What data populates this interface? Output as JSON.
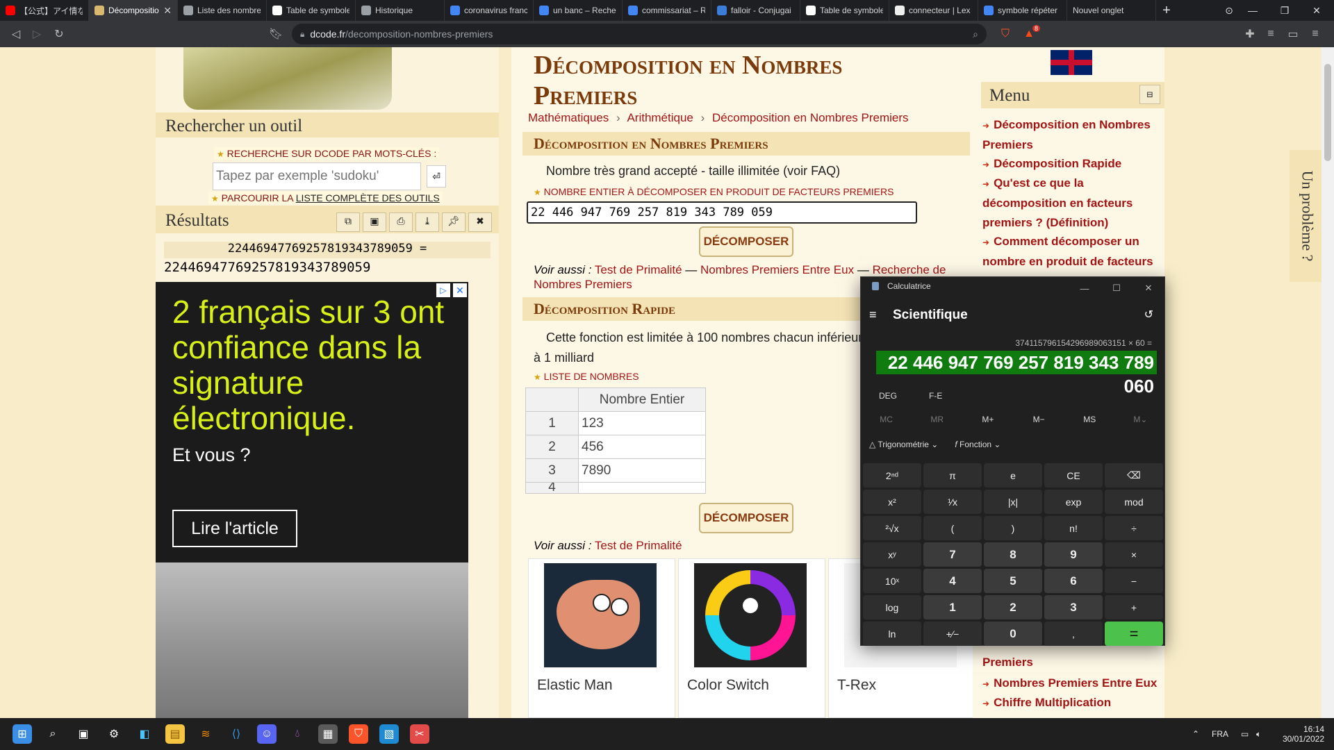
{
  "browser": {
    "tabs": [
      {
        "label": "【公式】アイ情な",
        "color": "#ff0000"
      },
      {
        "label": "Décompositio",
        "color": "#d9b870",
        "active": true
      },
      {
        "label": "Liste des nombre",
        "color": "#9aa0a6"
      },
      {
        "label": "Table de symbole",
        "color": "#ffffff"
      },
      {
        "label": "Historique",
        "color": "#9aa0a6"
      },
      {
        "label": "coronavirus franc",
        "color": "#4285f4"
      },
      {
        "label": "un banc – Recher",
        "color": "#4285f4"
      },
      {
        "label": "commissariat – R",
        "color": "#4285f4"
      },
      {
        "label": "falloir - Conjugai",
        "color": "#3b7dd8"
      },
      {
        "label": "Table de symbole",
        "color": "#ffffff"
      },
      {
        "label": "connecteur | Lex",
        "color": "#eeeeee"
      },
      {
        "label": "symbole répéter",
        "color": "#4285f4"
      },
      {
        "label": "Nouvel onglet",
        "color": ""
      }
    ],
    "new_tab": "+",
    "url_host": "dcode.fr",
    "url_path": "/decomposition-nombres-premiers",
    "shield_badge": "8"
  },
  "left": {
    "search_title": "Rechercher un outil",
    "search_label": "RECHERCHE SUR DCODE PAR MOTS-CLÉS :",
    "search_placeholder": "Tapez par exemple 'sudoku'",
    "browse_prefix": "PARCOURIR LA",
    "browse_link": "LISTE COMPLÈTE DES OUTILS",
    "results_title": "Résultats",
    "result_expr": "22446947769257819343789059 =",
    "result_value": "22446947769257819343789059",
    "ad_headline": "2 français sur 3 ont confiance dans la signature électronique.",
    "ad_sub": "Et vous ?",
    "ad_cta": "Lire l'article"
  },
  "main": {
    "page_title": "Décomposition en Nombres Premiers",
    "breadcrumb": [
      "Mathématiques",
      "Arithmétique",
      "Décomposition en Nombres Premiers"
    ],
    "breadcrumb_sep": "›",
    "sec1_title": "Décomposition en Nombres Premiers",
    "sec1_text": "Nombre très grand accepté - taille illimitée (voir FAQ)",
    "sec1_label": "NOMBRE ENTIER À DÉCOMPOSER EN PRODUIT DE FACTEURS PREMIERS",
    "sec1_input": "22 446 947 769 257 819 343 789 059",
    "decompose": "DÉCOMPOSER",
    "see_also": "Voir aussi :",
    "see_also_links_1": [
      "Test de Primalité",
      "Nombres Premiers Entre Eux",
      "Recherche de Nombres Premiers"
    ],
    "dash": "—",
    "sec2_title": "Décomposition Rapide",
    "sec2_text": "Cette fonction est limitée à 100 nombres chacun inférieur à 1 milliard",
    "sec2_label": "LISTE DE NOMBRES",
    "table_header": "Nombre Entier",
    "table_rows": [
      [
        "1",
        "123"
      ],
      [
        "2",
        "456"
      ],
      [
        "3",
        "7890"
      ],
      [
        "4",
        ""
      ]
    ],
    "see_also_links_2": [
      "Test de Primalité"
    ],
    "games": [
      "Elastic Man",
      "Color Switch",
      "T-Rex"
    ]
  },
  "right": {
    "menu_title": "Menu",
    "menu_items_top": [
      "Décomposition en Nombres Premiers",
      "Décomposition Rapide",
      "Qu'est ce que la décomposition en facteurs premiers ? (Définition)",
      "Comment décomposer un nombre en produit de facteurs"
    ],
    "menu_items_bottom": [
      "Premiers",
      "Nombres Premiers Entre Eux",
      "Chiffre Multiplication"
    ],
    "problem_tab": "Un problème ?"
  },
  "calc": {
    "app_title": "Calculatrice",
    "mode": "Scientifique",
    "expression": "374115796154296989063151 × 60 =",
    "display": "22 446 947 769 257 819 343 789 060",
    "deg": "DEG",
    "fe": "F-E",
    "memory": [
      "MC",
      "MR",
      "M+",
      "M−",
      "MS",
      "M⌄"
    ],
    "trig": "Trigonométrie",
    "func": "Fonction",
    "keys": [
      "2ⁿᵈ",
      "π",
      "e",
      "CE",
      "⌫",
      "x²",
      "¹⁄x",
      "|x|",
      "exp",
      "mod",
      "²√x",
      "(",
      ")",
      "n!",
      "÷",
      "xʸ",
      "7",
      "8",
      "9",
      "×",
      "10ˣ",
      "4",
      "5",
      "6",
      "−",
      "log",
      "1",
      "2",
      "3",
      "+",
      "ln",
      "+⁄−",
      "0",
      ",",
      "="
    ],
    "accent": "#107c10"
  },
  "taskbar": {
    "lang": "FRA",
    "time": "16:14",
    "date": "30/01/2022"
  }
}
